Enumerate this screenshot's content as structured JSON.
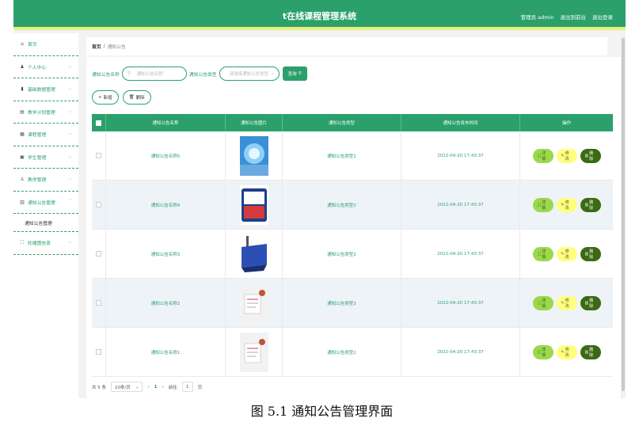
{
  "header": {
    "title": "t在线课程管理系统",
    "user_label": "管理员 admin",
    "back_label": "退出到前台",
    "logout_label": "退出登录"
  },
  "sidebar": {
    "items": [
      {
        "label": "首页",
        "icon": "home-icon"
      },
      {
        "label": "个人中心",
        "icon": "user-icon"
      },
      {
        "label": "基础数据管理",
        "icon": "chart-icon"
      },
      {
        "label": "教学计划管理",
        "icon": "plan-icon"
      },
      {
        "label": "课程管理",
        "icon": "course-icon"
      },
      {
        "label": "学生管理",
        "icon": "student-icon"
      },
      {
        "label": "教师管理",
        "icon": "teacher-icon"
      },
      {
        "label": "通知公告管理",
        "icon": "notice-icon"
      },
      {
        "label": "轮播图信息",
        "icon": "carousel-icon"
      }
    ],
    "sub_item": "通知公告管理"
  },
  "breadcrumb": {
    "home": "首页",
    "sep": "/",
    "current": "通知公告"
  },
  "search": {
    "name_label": "通知公告名称",
    "name_placeholder": "通知公告名称",
    "type_label": "通知公告类型",
    "type_placeholder": "请选择通知公告类型",
    "query_label": "查询"
  },
  "actions": {
    "add_label": "新增",
    "delete_label": "删除"
  },
  "table": {
    "headers": [
      "通知公告名称",
      "通知公告图片",
      "通知公告类型",
      "通知公告发布时间",
      "操作"
    ],
    "rows": [
      {
        "name": "通知公告名称5",
        "image": "globe-image",
        "type": "通知公告类型2",
        "time": "2022-04-20 17:43:37"
      },
      {
        "name": "通知公告名称4",
        "image": "cctv-news-image",
        "type": "通知公告类型2",
        "time": "2022-04-20 17:43:37"
      },
      {
        "name": "通知公告名称3",
        "image": "news-sign-image",
        "type": "通知公告类型2",
        "time": "2022-04-20 17:43:37"
      },
      {
        "name": "通知公告名称2",
        "image": "notice-paper-image",
        "type": "通知公告类型2",
        "time": "2022-04-20 17:43:37"
      },
      {
        "name": "通知公告名称1",
        "image": "notice-paper-image",
        "type": "通知公告类型2",
        "time": "2022-04-20 17:43:37"
      }
    ],
    "op_detail": "详情",
    "op_edit": "修改",
    "op_delete": "删除"
  },
  "pager": {
    "total": "共 5 条",
    "page_size": "10条/页",
    "current_page": "1",
    "goto_label": "前往",
    "goto_value": "1",
    "page_unit": "页"
  },
  "caption": "图 5.1 通知公告管理界面",
  "colors": {
    "primary": "#2ba06b",
    "accent_bar": "#e6f17a",
    "detail": "#9bd84c",
    "edit": "#ffff7a",
    "delete": "#3b6a13"
  }
}
